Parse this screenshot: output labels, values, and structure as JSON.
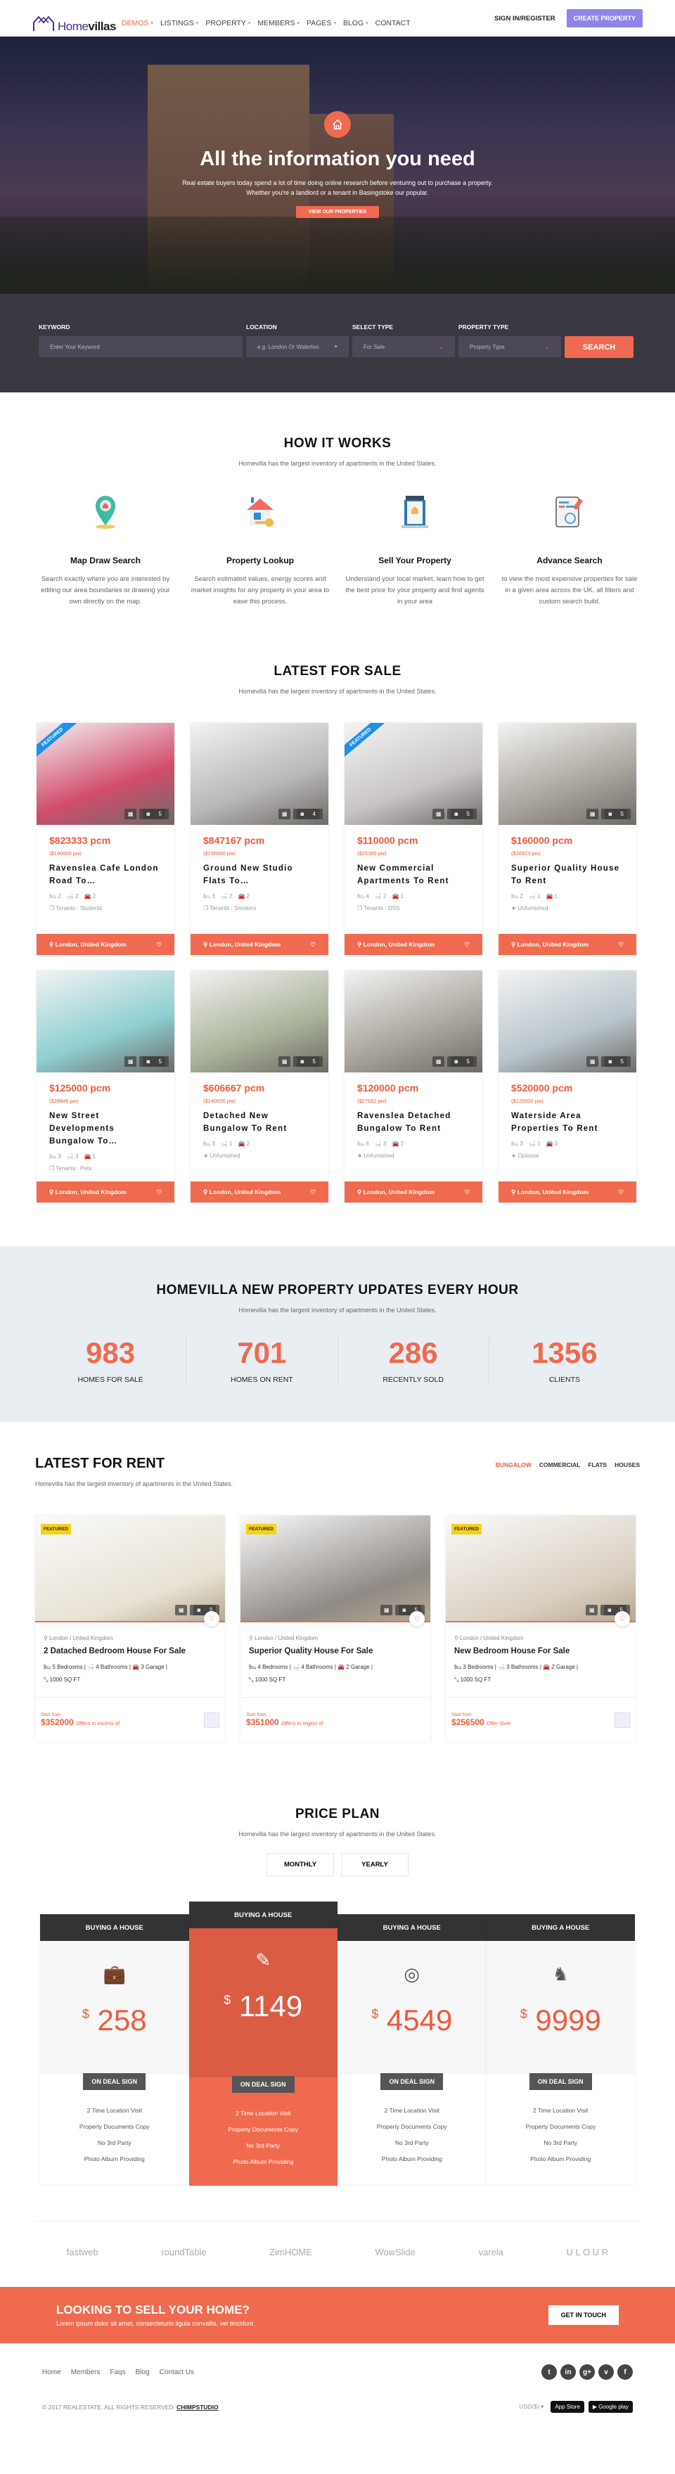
{
  "header": {
    "logo": {
      "part1": "Home",
      "part2": "villas"
    },
    "nav": [
      {
        "label": "DEMOS",
        "dropdown": true,
        "active": true
      },
      {
        "label": "LISTINGS",
        "dropdown": true
      },
      {
        "label": "PROPERTY",
        "dropdown": true
      },
      {
        "label": "MEMBERS",
        "dropdown": true
      },
      {
        "label": "PAGES",
        "dropdown": true
      },
      {
        "label": "BLOG",
        "dropdown": true
      },
      {
        "label": "CONTACT",
        "dropdown": false
      }
    ],
    "sign_in": "SIGN IN/REGISTER",
    "create_property": "CREATE PROPERTY",
    "accent": "#8f84e8"
  },
  "hero": {
    "icon": "house-icon",
    "title": "All the information you need",
    "line1": "Real estate buyers today spend a lot of time doing online research before venturing out to purchase a property.",
    "line2": "Whether you're a landlord or a tenant in Basingstoke our popular.",
    "button": "VIEW OUR PROPERTIES"
  },
  "search": {
    "keyword": {
      "label": "KEYWORD",
      "placeholder": "Enter Your Keyword"
    },
    "location": {
      "label": "LOCATION",
      "placeholder": "e.g. London Or Waterloo"
    },
    "select_type": {
      "label": "SELECT TYPE",
      "value": "For Sale"
    },
    "property_type": {
      "label": "PROPERTY TYPE",
      "value": "Property Type"
    },
    "button": "SEARCH"
  },
  "how": {
    "title": "HOW IT WORKS",
    "subtitle": "Homevilla has the largest inventory of apartments in the United States.",
    "items": [
      {
        "icon": "map-pin-icon",
        "title": "Map Draw Search",
        "text": "Search exactly where you are interested by editing our area boundaries  or drawing your own directly on the map."
      },
      {
        "icon": "house-key-icon",
        "title": "Property Lookup",
        "text": "Search estimated values, energy scores and market insights for any property in your area to ease this process."
      },
      {
        "icon": "laptop-listing-icon",
        "title": "Sell Your Property",
        "text": "Understand your local market, learn how to get the best price for your property and find agents in your area"
      },
      {
        "icon": "document-search-icon",
        "title": "Advance Search",
        "text": "to view the most expensive properties for sale in a given area across the UK. all filters and custom search build."
      }
    ]
  },
  "sale": {
    "title": "LATEST FOR SALE",
    "subtitle": "Homevilla has the largest inventory of apartments in the United States.",
    "cards": [
      {
        "featured": true,
        "photos": "5",
        "price": "$823333 pcm",
        "pw": "($190000 pw)",
        "title": "Ravenslea Cafe London Road To…",
        "beds": "2",
        "baths": "2",
        "garage": "2",
        "extra": "Tenants : Students",
        "location": "London, United Kingdom",
        "img": "#d24d6c"
      },
      {
        "featured": false,
        "photos": "4",
        "price": "$847167 pcm",
        "pw": "($195500 pw)",
        "title": "Ground New Studio Flats To…",
        "beds": "3",
        "baths": "2",
        "garage": "2",
        "extra": "Tenants : Smokers",
        "location": "London, United Kingdom",
        "img": "#b9b7b8"
      },
      {
        "featured": true,
        "photos": "5",
        "price": "$110000 pcm",
        "pw": "($25385 pw)",
        "title": "New Commercial Apartments To Rent",
        "beds": "4",
        "baths": "2",
        "garage": "1",
        "extra": "Tenants : DSS",
        "location": "London, United Kingdom",
        "img": "#c9c5c7"
      },
      {
        "featured": false,
        "photos": "5",
        "price": "$160000 pcm",
        "pw": "($36923 pw)",
        "title": "Superior Quality House To Rent",
        "beds": "2",
        "baths": "1",
        "garage": "1",
        "extra": "Unfurnished",
        "location": "London, United Kingdom",
        "img": "#a9a49c"
      },
      {
        "featured": false,
        "photos": "5",
        "price": "$125000 pcm",
        "pw": "($28846 pw)",
        "title": "New Street Developments Bungalow To…",
        "beds": "3",
        "baths": "3",
        "garage": "1",
        "extra": "Tenants : Pets",
        "location": "London, United Kingdom",
        "img": "#8fcfd2"
      },
      {
        "featured": false,
        "photos": "5",
        "price": "$606667 pcm",
        "pw": "($140000 pw)",
        "title": "Detached New Bungalow To Rent",
        "beds": "3",
        "baths": "1",
        "garage": "2",
        "extra": "Unfurnished",
        "location": "London, United Kingdom",
        "img": "#aab39a"
      },
      {
        "featured": false,
        "photos": "5",
        "price": "$120000 pcm",
        "pw": "($27692 pw)",
        "title": "Ravenslea Detached Bungalow To Rent",
        "beds": "6",
        "baths": "3",
        "garage": "2",
        "extra": "Unfurnished",
        "location": "London, United Kingdom",
        "img": "#a9a49c"
      },
      {
        "featured": false,
        "photos": "5",
        "price": "$520000 pcm",
        "pw": "($120000 pw)",
        "title": "Waterside Area Properties To Rent",
        "beds": "3",
        "baths": "1",
        "garage": "3",
        "extra": "Optional",
        "location": "London, United Kingdom",
        "img": "#b8c5cc"
      }
    ]
  },
  "stats": {
    "title": "HOMEVILLA NEW PROPERTY UPDATES EVERY HOUR",
    "subtitle": "Homevilla has the largest inventory of apartments in the United States.",
    "items": [
      {
        "num": "983",
        "label": "HOMES FOR SALE"
      },
      {
        "num": "701",
        "label": "HOMES ON RENT"
      },
      {
        "num": "286",
        "label": "RECENTLY SOLD"
      },
      {
        "num": "1356",
        "label": "CLIENTS"
      }
    ]
  },
  "rent": {
    "title": "LATEST FOR RENT",
    "subtitle": "Homevilla has the largest inventory of apartments in the United States.",
    "tabs": [
      "BUNGALOW",
      "COMMERCIAL",
      "FLATS",
      "HOUSES"
    ],
    "active_tab": "BUNGALOW",
    "cards": [
      {
        "featured": "FEATURED",
        "photos": "3",
        "location": "London / United Kingdom",
        "title": "2 Datached Bedroom House For Sale",
        "beds": "5 Bedrooms",
        "baths": "4 Bathrooms",
        "garage": "3 Garage",
        "area": "1000 SQ FT",
        "start": "Start from",
        "price": "$352000",
        "offer": "Offers in excess of",
        "img": "#e8e2d4"
      },
      {
        "featured": "FEATURED",
        "photos": "5",
        "location": "London / United Kingdom",
        "title": "Superior Quality House For Sale",
        "beds": "4 Bedrooms",
        "baths": "4 Bathrooms",
        "garage": "2 Garage",
        "area": "1000 SQ FT",
        "start": "Start from",
        "price": "$351000",
        "offer": "Offers in region of",
        "img": "#8f8a86"
      },
      {
        "featured": "FEATURED",
        "photos": "5",
        "location": "London / United Kingdom",
        "title": "New Bedroom House For Sale",
        "beds": "3 Bedrooms",
        "baths": "3 Bathrooms",
        "garage": "2 Garage",
        "area": "1000 SQ FT",
        "start": "Start from",
        "price": "$256500",
        "offer": "Offer Over",
        "img": "#d9cfc0"
      }
    ]
  },
  "plans": {
    "title": "PRICE PLAN",
    "subtitle": "Homevilla has the largest inventory of apartments in the United States.",
    "toggle": [
      "MONTHLY",
      "YEARLY"
    ],
    "items": [
      {
        "head": "BUYING A HOUSE",
        "icon": "briefcase-icon",
        "glyph": "💼",
        "currency": "$",
        "price": "258",
        "button": "ON DEAL SIGN",
        "features": [
          "2 Time Location Visit",
          "Property Documents Copy",
          "No 3rd Party",
          "Photo Album Providing"
        ],
        "highlight": false
      },
      {
        "head": "BUYING A HOUSE",
        "icon": "pencil-ruler-icon",
        "glyph": "✎",
        "currency": "$",
        "price": "1149",
        "button": "ON DEAL SIGN",
        "features": [
          "2 Time Location Visit",
          "Property Documents Copy",
          "No 3rd Party",
          "Photo Album Providing"
        ],
        "highlight": true
      },
      {
        "head": "BUYING A HOUSE",
        "icon": "target-icon",
        "glyph": "◎",
        "currency": "$",
        "price": "4549",
        "button": "ON DEAL SIGN",
        "features": [
          "2 Time Location Visit",
          "Property Documents Copy",
          "No 3rd Party",
          "Photo Album Providing"
        ],
        "highlight": false
      },
      {
        "head": "BUYING A HOUSE",
        "icon": "chess-knight-icon",
        "glyph": "♞",
        "currency": "$",
        "price": "9999",
        "button": "ON DEAL SIGN",
        "features": [
          "2 Time Location Visit",
          "Property Documents Copy",
          "No 3rd Party",
          "Photo Album Providing"
        ],
        "highlight": false
      }
    ]
  },
  "partners": [
    "fastweb",
    "roundTable",
    "ZimHOME",
    "WowSlide",
    "varela",
    "U L O U R"
  ],
  "cta": {
    "title": "LOOKING TO SELL YOUR HOME?",
    "text": "Lorem ipsum dolor sit amet, consecteturin ligula convallis, vel tincidunt.",
    "button": "GET IN TOUCH"
  },
  "footer": {
    "links": [
      "Home",
      "Members",
      "Faqs",
      "Blog",
      "Contact Us"
    ],
    "social": [
      {
        "icon": "twitter-icon",
        "glyph": "t"
      },
      {
        "icon": "linkedin-icon",
        "glyph": "in"
      },
      {
        "icon": "google-plus-icon",
        "glyph": "g+"
      },
      {
        "icon": "vimeo-icon",
        "glyph": "v"
      },
      {
        "icon": "facebook-icon",
        "glyph": "f"
      }
    ],
    "copyright": "© 2017 REALESTATE. ALL RIGHTS RESERVED.",
    "brand": "CHIMPSTUDIO",
    "currency": "USD($) ▾",
    "app_store": "App Store",
    "google_play": "Google play"
  }
}
